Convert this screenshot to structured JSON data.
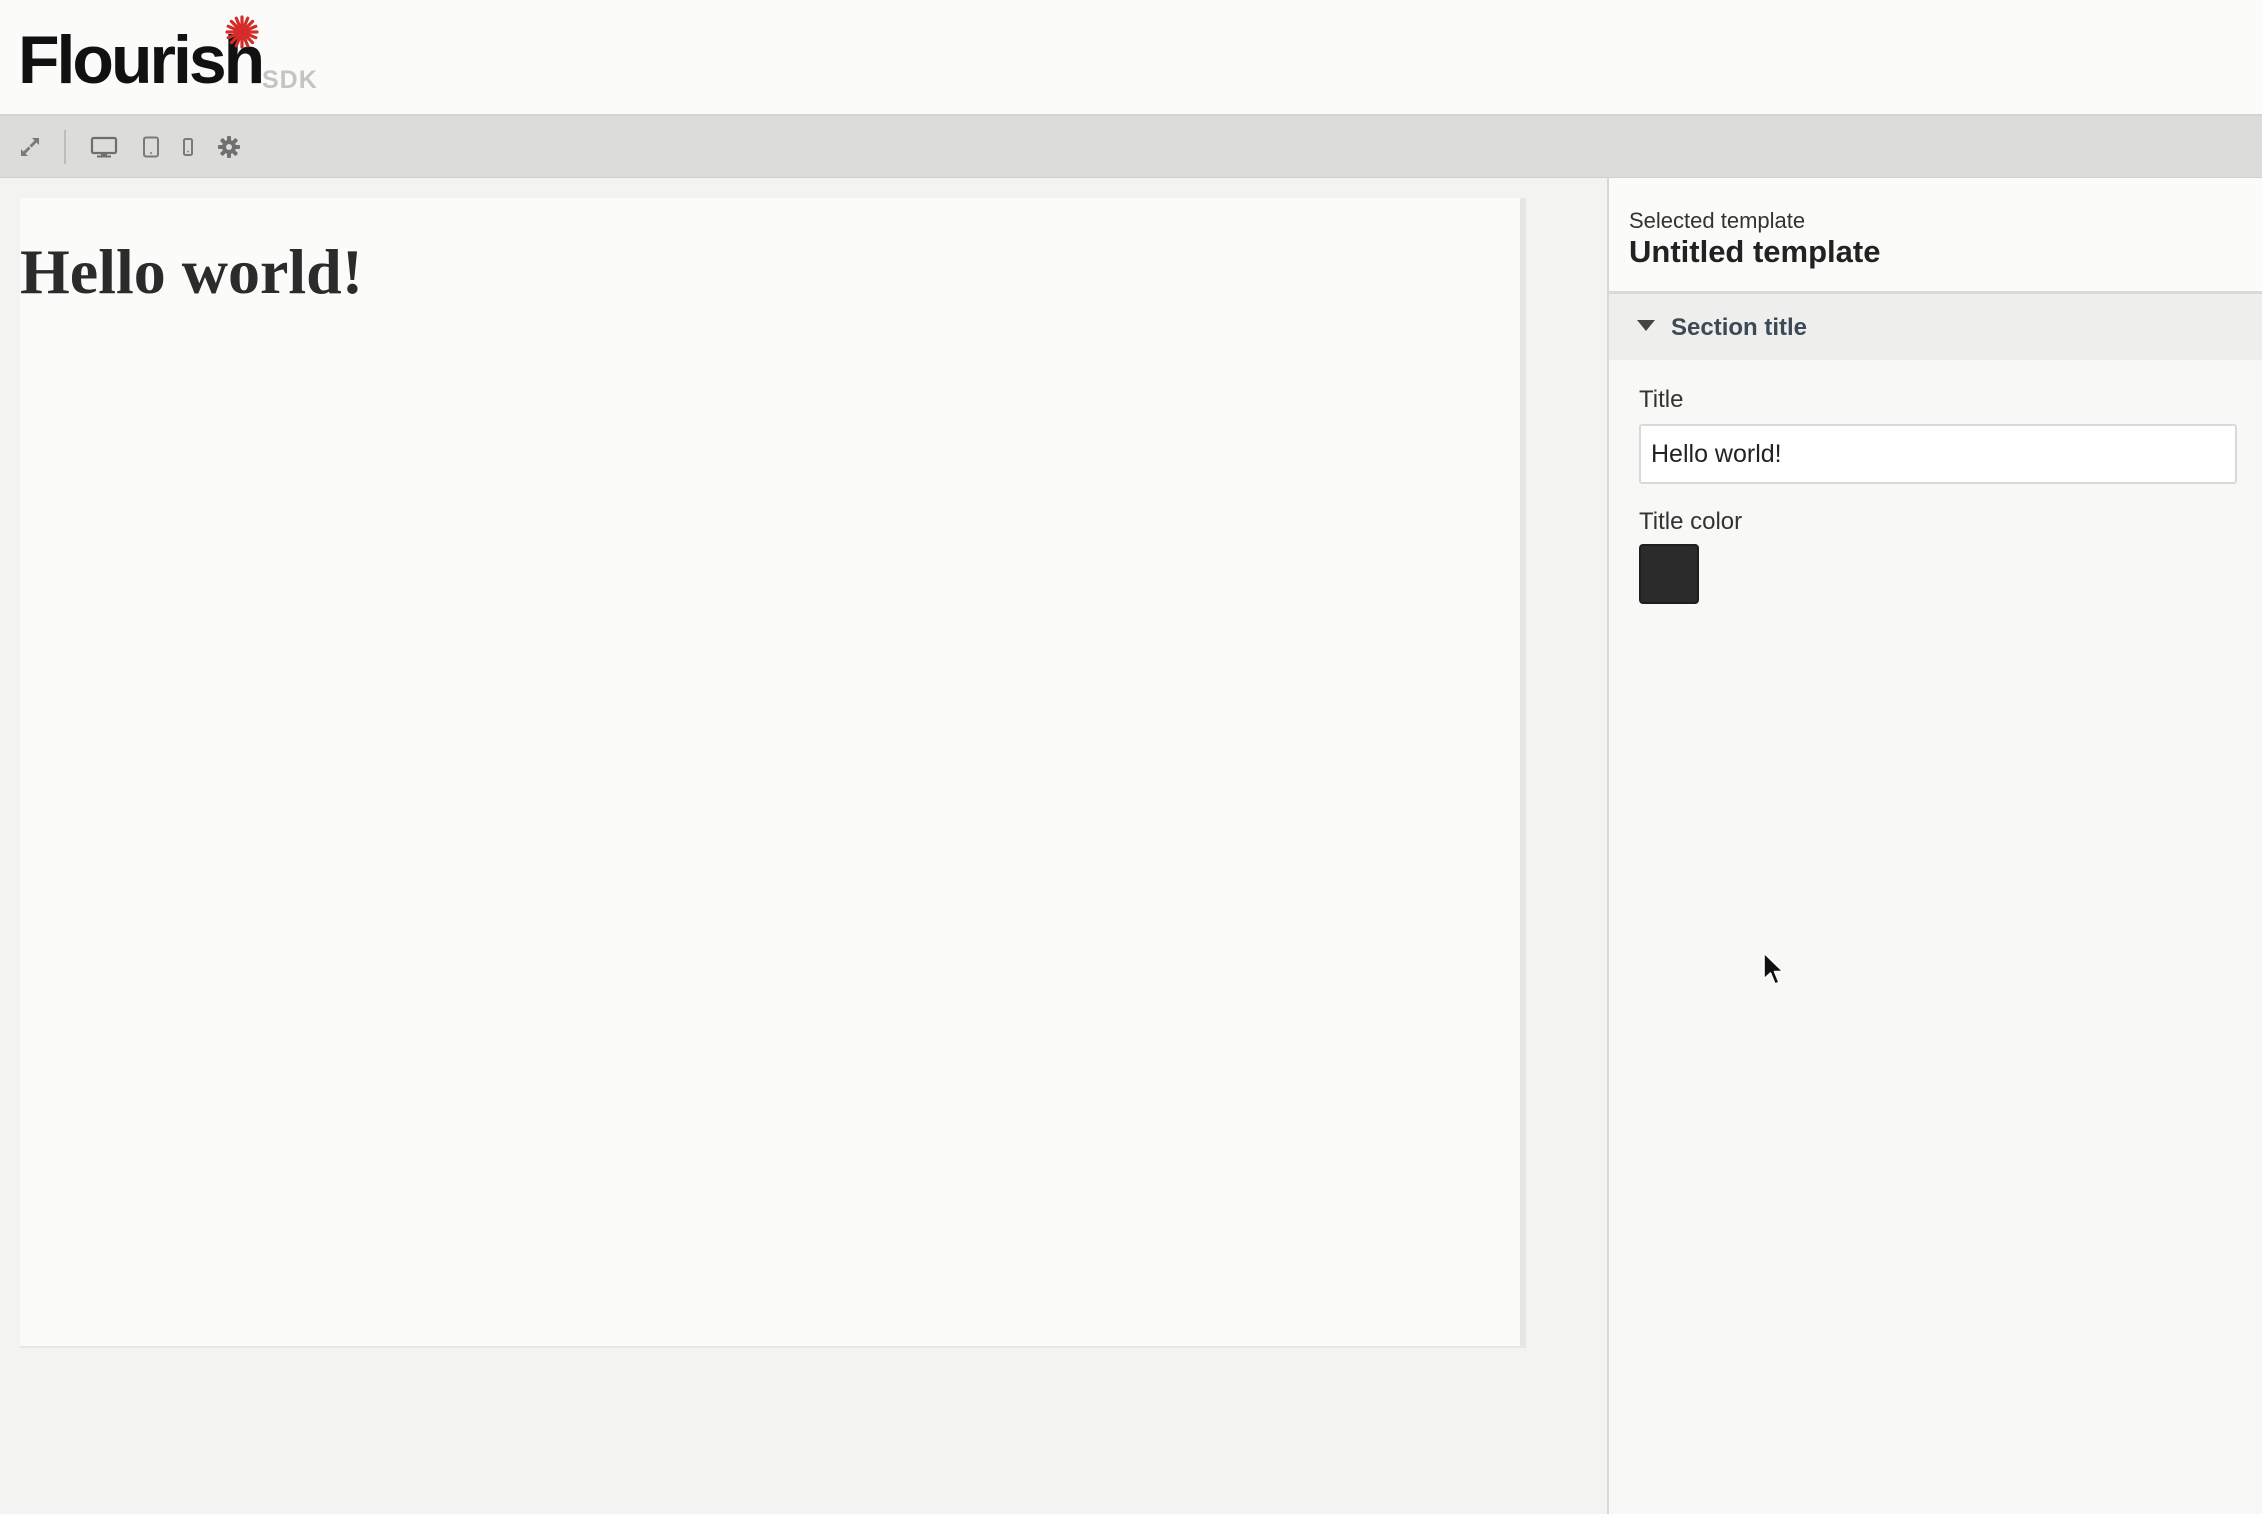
{
  "header": {
    "logo_text": "Flourish",
    "logo_badge": "SDK",
    "brand_accent_color": "#d42b2b"
  },
  "toolbar": {
    "items": [
      {
        "icon": "expand-icon"
      },
      {
        "icon": "desktop-icon"
      },
      {
        "icon": "tablet-icon"
      },
      {
        "icon": "mobile-icon"
      },
      {
        "icon": "gear-icon"
      }
    ]
  },
  "preview": {
    "title": "Hello world!",
    "title_color": "#2b2b2b"
  },
  "panel": {
    "selected_label": "Selected template",
    "selected_name": "Untitled template",
    "section": {
      "title": "Section title",
      "expanded": true
    },
    "fields": {
      "title_label": "Title",
      "title_value": "Hello world!",
      "color_label": "Title color",
      "color_value": "#2b2b2b"
    }
  }
}
